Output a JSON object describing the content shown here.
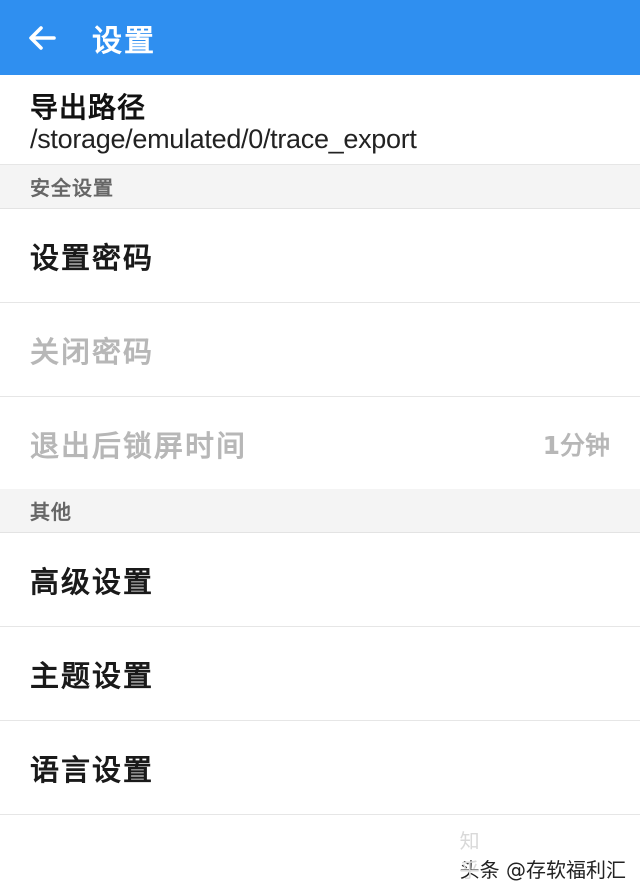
{
  "header": {
    "title": "设置",
    "back_icon": "arrow-left-icon",
    "color": "#2f8ff0"
  },
  "export": {
    "label": "导出路径",
    "path": "/storage/emulated/0/trace_export"
  },
  "sections": {
    "security": "安全设置",
    "other": "其他"
  },
  "security_items": {
    "set_password": "设置密码",
    "close_password": "关闭密码",
    "lock_after_exit": {
      "label": "退出后锁屏时间",
      "value": "1分钟"
    }
  },
  "other_items": {
    "advanced": "高级设置",
    "theme": "主题设置",
    "language": "语言设置"
  },
  "watermark": {
    "ghost": "知乎",
    "text": "头条 @存软福利汇"
  }
}
